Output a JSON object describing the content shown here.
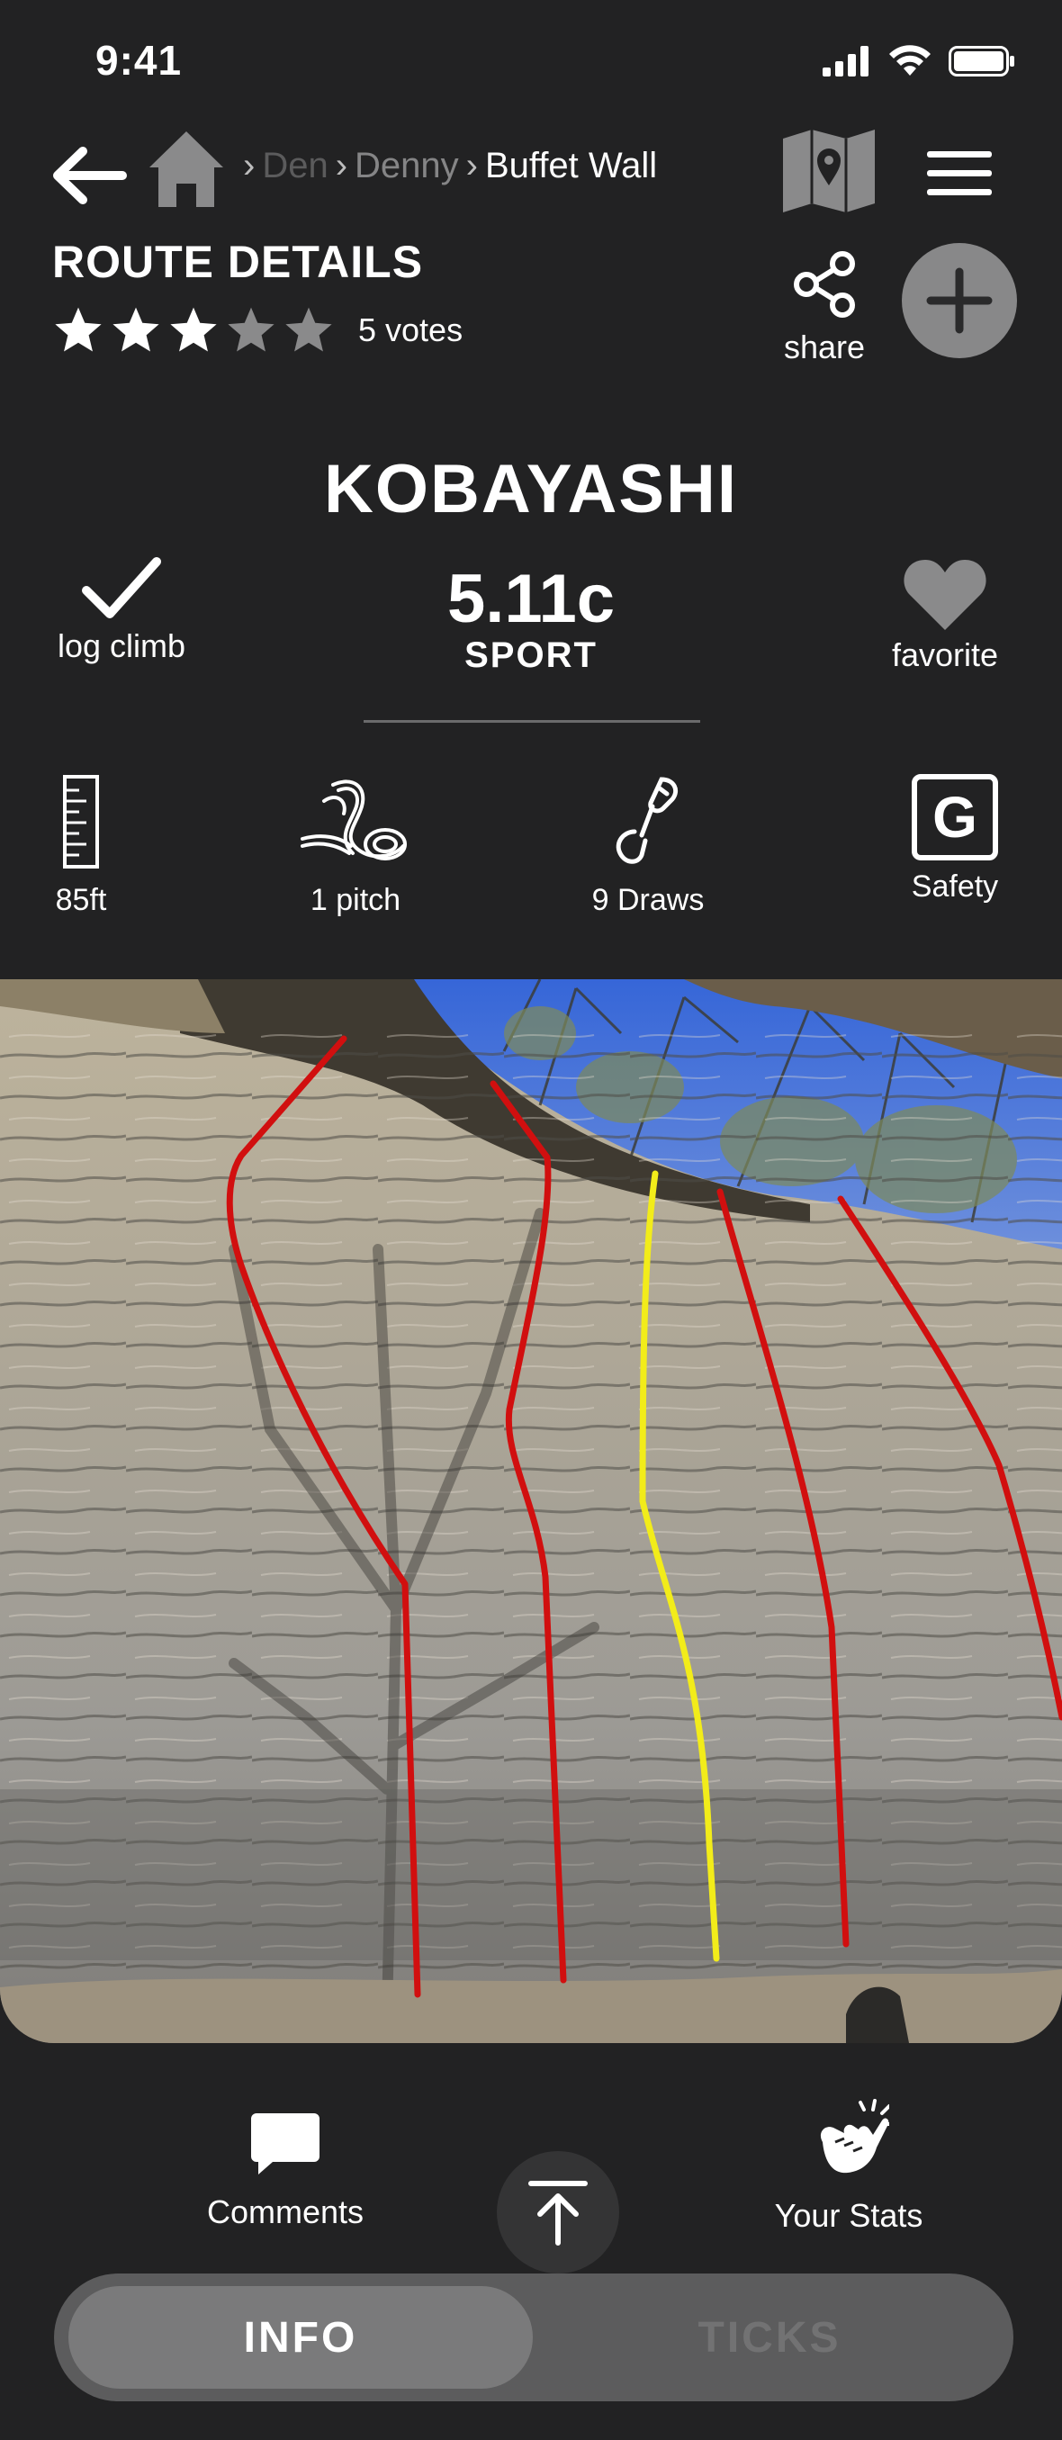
{
  "status_bar": {
    "time": "9:41"
  },
  "nav": {
    "breadcrumbs": [
      {
        "label": "Den"
      },
      {
        "label": "Denny"
      },
      {
        "label": "Buffet Wall"
      }
    ]
  },
  "route": {
    "section_title": "ROUTE DETAILS",
    "rating_stars": 3,
    "rating_max": 5,
    "votes": "5 votes",
    "share_label": "share",
    "name": "KOBAYASHI",
    "log_label": "log climb",
    "grade": "5.11c",
    "type": "SPORT",
    "favorite_label": "favorite",
    "stats": {
      "length": "85ft",
      "pitches": "1 pitch",
      "draws": "9 Draws",
      "safety_badge": "G",
      "safety_label": "Safety"
    }
  },
  "bottom": {
    "comments_label": "Comments",
    "stats_label": "Your Stats"
  },
  "tabs": [
    {
      "label": "INFO",
      "active": true
    },
    {
      "label": "TICKS",
      "active": false
    }
  ],
  "colors": {
    "background": "#222223",
    "route_line": "#d10f0f",
    "selected_route_line": "#f2ec1a",
    "button_gray": "#888889"
  },
  "icons": [
    "back-arrow-icon",
    "home-icon",
    "map-icon",
    "menu-icon",
    "share-icon",
    "plus-icon",
    "checkmark-icon",
    "heart-icon",
    "ruler-icon",
    "rope-icon",
    "quickdraw-icon",
    "comment-icon",
    "arrow-up-icon",
    "pointing-hand-icon"
  ]
}
